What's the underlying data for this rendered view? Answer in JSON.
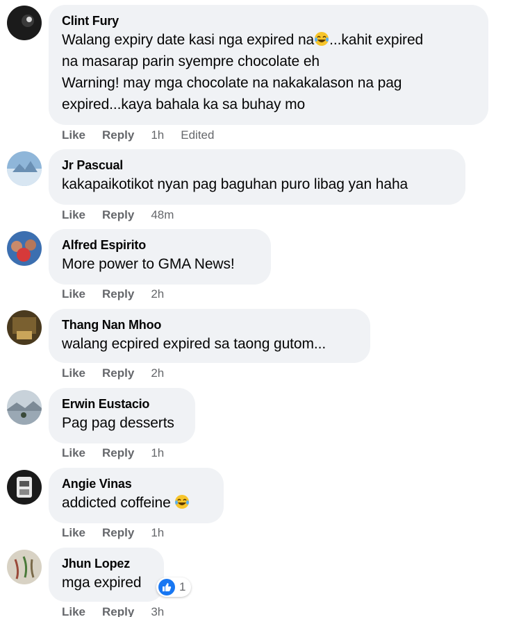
{
  "labels": {
    "like": "Like",
    "reply": "Reply"
  },
  "comments": [
    {
      "author": "Clint Fury",
      "text_part1": "Walang expiry date kasi nga expired na",
      "emoji": "laughing-tears-emoji",
      "text_part2": "...kahit expired\nna masarap parin syempre chocolate eh\nWarning! may mga chocolate na nakakalason na pag\nexpired...kaya bahala ka sa buhay mo",
      "time": "1h",
      "edited": "Edited"
    },
    {
      "author": "Jr Pascual",
      "text": "kakapaikotikot nyan pag baguhan puro libag yan haha",
      "time": "48m"
    },
    {
      "author": "Alfred Espirito",
      "text": "More power to GMA News!",
      "time": "2h"
    },
    {
      "author": "Thang Nan Mhoo",
      "text": "walang ecpired expired sa taong gutom...",
      "time": "2h"
    },
    {
      "author": "Erwin Eustacio",
      "text": "Pag pag desserts",
      "time": "1h"
    },
    {
      "author": "Angie Vinas",
      "text": "addicted coffeine ",
      "emoji": "laughing-tears-emoji",
      "time": "1h"
    },
    {
      "author": "Jhun Lopez",
      "text": "mga expired",
      "time": "3h",
      "reaction": {
        "icon": "like-reaction-icon",
        "count": "1"
      }
    }
  ],
  "colors": {
    "bubble": "#f0f2f5",
    "meta": "#65676b",
    "like_blue": "#1877f2"
  }
}
